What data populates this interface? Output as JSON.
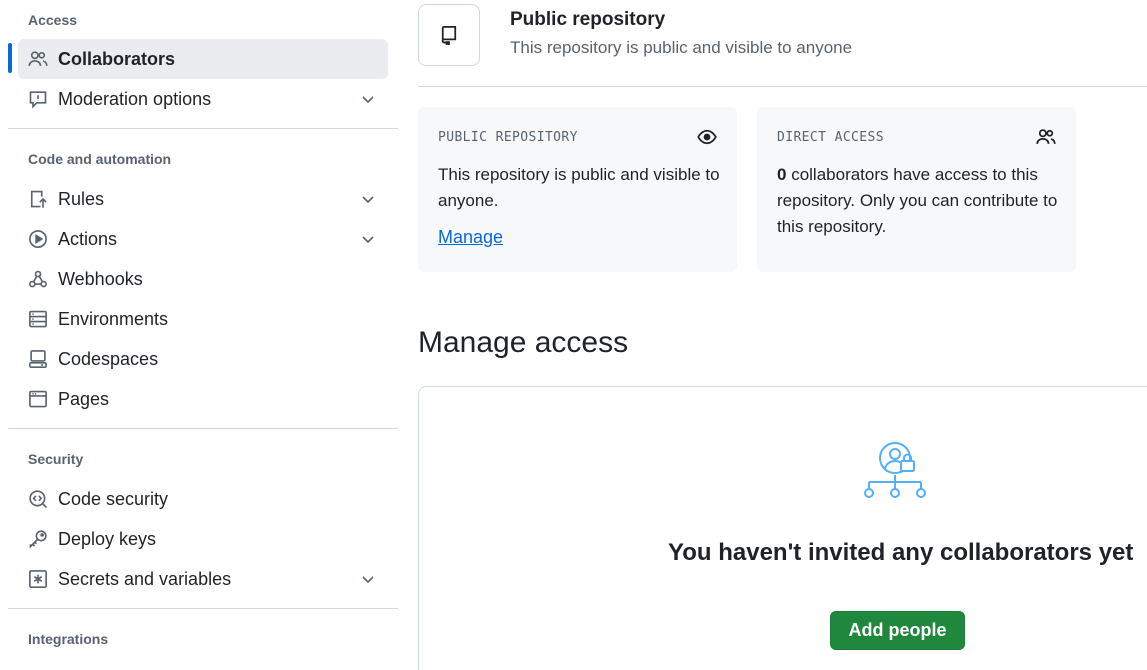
{
  "sidebar": {
    "sections": {
      "access": "Access",
      "code_automation": "Code and automation",
      "security": "Security",
      "integrations": "Integrations"
    },
    "items": [
      {
        "label": "Collaborators",
        "icon": "people-icon",
        "active": true
      },
      {
        "label": "Moderation options",
        "icon": "report-icon",
        "expandable": true
      },
      {
        "label": "Rules",
        "icon": "repo-push-icon",
        "expandable": true
      },
      {
        "label": "Actions",
        "icon": "play-icon",
        "expandable": true
      },
      {
        "label": "Webhooks",
        "icon": "webhook-icon"
      },
      {
        "label": "Environments",
        "icon": "server-icon"
      },
      {
        "label": "Codespaces",
        "icon": "codespaces-icon"
      },
      {
        "label": "Pages",
        "icon": "browser-icon"
      },
      {
        "label": "Code security",
        "icon": "codescan-icon"
      },
      {
        "label": "Deploy keys",
        "icon": "key-icon"
      },
      {
        "label": "Secrets and variables",
        "icon": "asterisk-icon",
        "expandable": true
      }
    ]
  },
  "header": {
    "title": "Public repository",
    "subtitle": "This repository is public and visible to anyone"
  },
  "cards": {
    "public": {
      "kicker": "PUBLIC REPOSITORY",
      "body": "This repository is public and visible to anyone.",
      "link": "Manage"
    },
    "direct": {
      "kicker": "DIRECT ACCESS",
      "count": "0",
      "body": " collaborators have access to this repository. Only you can contribute to this repository."
    }
  },
  "manage": {
    "heading": "Manage access",
    "empty_title": "You haven't invited any collaborators yet",
    "button": "Add people"
  },
  "colors": {
    "accent": "#0969da",
    "primary_button": "#1f883d",
    "illustration": "#54aeff"
  }
}
